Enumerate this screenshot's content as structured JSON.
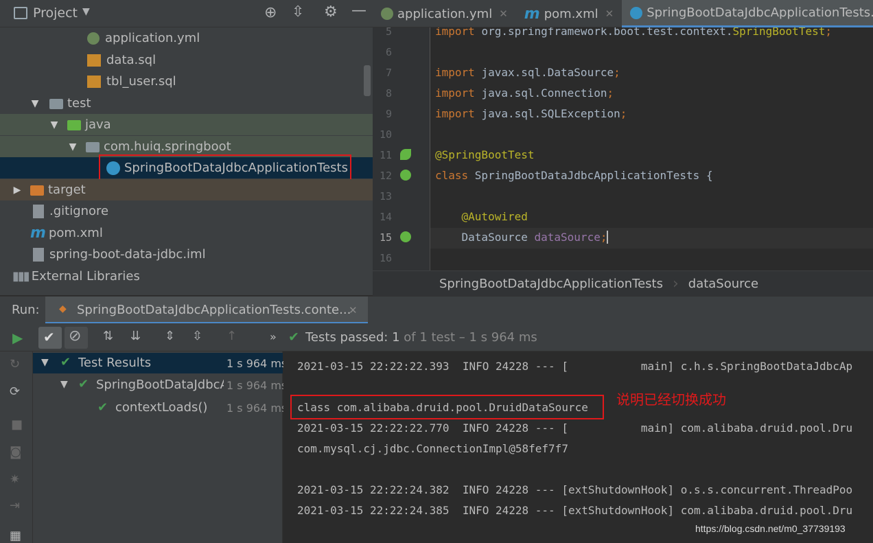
{
  "project_panel": {
    "title": "Project",
    "tree": [
      {
        "label": "application.yml"
      },
      {
        "label": "data.sql"
      },
      {
        "label": "tbl_user.sql"
      },
      {
        "label": "test"
      },
      {
        "label": "java"
      },
      {
        "label": "com.huiq.springboot"
      },
      {
        "label": "SpringBootDataJdbcApplicationTests"
      },
      {
        "label": "target"
      },
      {
        "label": ".gitignore"
      },
      {
        "label": "pom.xml"
      },
      {
        "label": "spring-boot-data-jdbc.iml"
      },
      {
        "label": "External Libraries"
      }
    ]
  },
  "editor": {
    "tabs": [
      {
        "label": "application.yml",
        "close": "✕"
      },
      {
        "label": "pom.xml",
        "close": "✕"
      },
      {
        "label": "SpringBootDataJdbcApplicationTests.j"
      }
    ],
    "lines": [
      {
        "num": "5",
        "text": "import org.springframework.boot.test.context.SpringBootTest;"
      },
      {
        "num": "6",
        "text": ""
      },
      {
        "num": "7",
        "text": "import javax.sql.DataSource;"
      },
      {
        "num": "8",
        "text": "import java.sql.Connection;"
      },
      {
        "num": "9",
        "text": "import java.sql.SQLException;"
      },
      {
        "num": "10",
        "text": ""
      },
      {
        "num": "11",
        "text": "@SpringBootTest"
      },
      {
        "num": "12",
        "text": "class SpringBootDataJdbcApplicationTests {"
      },
      {
        "num": "13",
        "text": ""
      },
      {
        "num": "14",
        "text": "    @Autowired"
      },
      {
        "num": "15",
        "text": "    DataSource dataSource;"
      },
      {
        "num": "16",
        "text": ""
      }
    ],
    "breadcrumb": [
      "SpringBootDataJdbcApplicationTests",
      "dataSource"
    ]
  },
  "run_panel": {
    "label": "Run:",
    "tab": "SpringBootDataJdbcApplicationTests.conte...",
    "tab_close": "✕",
    "more": "»",
    "status_passed": "Tests passed:",
    "status_count": "1",
    "status_rest": "of 1 test – 1 s 964 ms",
    "results": [
      {
        "label": "Test Results",
        "time": "1 s 964 ms"
      },
      {
        "label": "SpringBootDataJdbcA",
        "time": "1 s 964 ms"
      },
      {
        "label": "contextLoads()",
        "time": "1 s 964 ms"
      }
    ],
    "console": [
      "2021-03-15 22:22:22.393  INFO 24228 --- [           main] c.h.s.SpringBootDataJdbcAp",
      "",
      "class com.alibaba.druid.pool.DruidDataSource",
      "2021-03-15 22:22:22.770  INFO 24228 --- [           main] com.alibaba.druid.pool.Dru",
      "com.mysql.cj.jdbc.ConnectionImpl@58fef7f7",
      "",
      "2021-03-15 22:22:24.382  INFO 24228 --- [extShutdownHook] o.s.s.concurrent.ThreadPoo",
      "2021-03-15 22:22:24.385  INFO 24228 --- [extShutdownHook] com.alibaba.druid.pool.Dru"
    ],
    "annotation": "说明已经切换成功",
    "watermark": "https://blog.csdn.net/m0_37739193"
  },
  "colors": {
    "highlight_box": "#e0191b",
    "pass_green": "#499c54",
    "keyword": "#cc7832",
    "annotation": "#bbb529"
  }
}
